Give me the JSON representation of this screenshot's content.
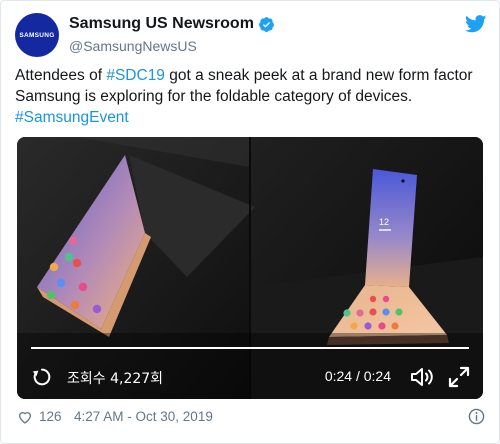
{
  "account": {
    "display_name": "Samsung US Newsroom",
    "handle": "@SamsungNewsUS",
    "avatar_text": "SAMSUNG",
    "verified": true
  },
  "tweet": {
    "text_prefix": "Attendees of ",
    "hashtag1": "#SDC19",
    "text_middle": " got a sneak peek at a brand new form factor Samsung is exploring for the foldable category of devices.",
    "hashtag2": "#SamsungEvent"
  },
  "video": {
    "views": "조회수 4,227회",
    "time": "0:24 / 0:24",
    "progress": 1.0,
    "clock_on_phone": "12"
  },
  "footer": {
    "likes": "126",
    "timestamp": "4:27 AM - Oct 30, 2019"
  },
  "icons": {
    "verified": "verified-badge-icon",
    "brand": "twitter-bird-icon",
    "replay": "replay-icon",
    "volume": "volume-icon",
    "fullscreen": "fullscreen-icon",
    "like": "heart-icon",
    "info": "info-icon"
  },
  "colors": {
    "link": "#1b95e0",
    "avatar": "#1428a0",
    "muted": "#657786",
    "twitter_blue": "#1da1f2"
  }
}
